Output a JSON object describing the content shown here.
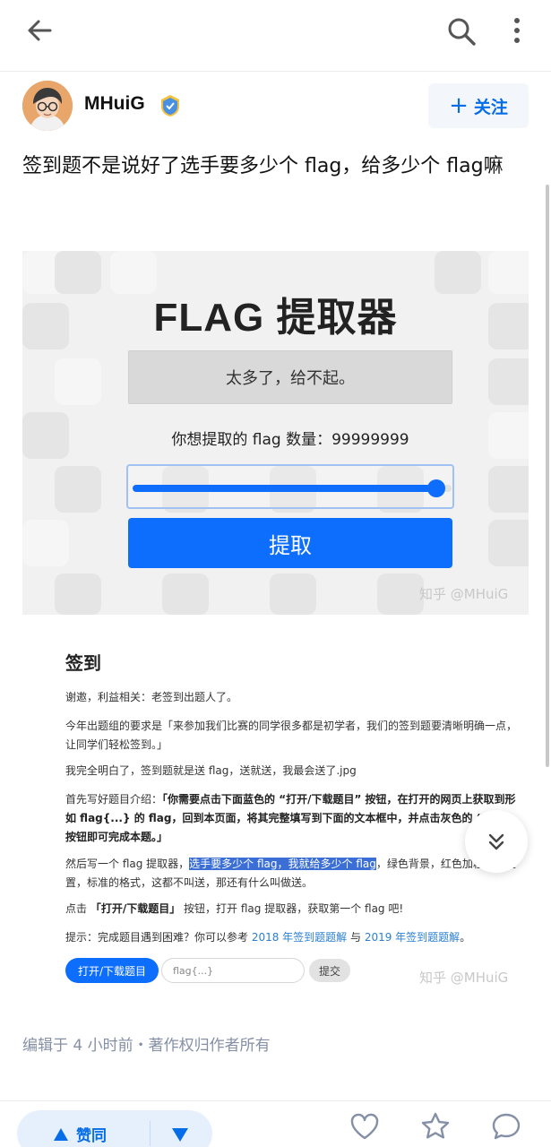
{
  "author": {
    "name": "MHuiG",
    "follow_label": "关注"
  },
  "answer": {
    "title": "签到题不是说好了选手要多少个 flag，给多少个 flag嘛",
    "edited": "编辑于 4 小时前・著作权归作者所有"
  },
  "image1": {
    "heading": "FLAG 提取器",
    "message": "太多了，给不起。",
    "count_label": "你想提取的 flag 数量：99999999",
    "slider_level": 0.96,
    "button": "提取",
    "watermark": "知乎 @MHuiG"
  },
  "image2": {
    "heading": "签到",
    "p1": "谢邀，利益相关：老签到出题人了。",
    "p2": "今年出题组的要求是「来参加我们比赛的同学很多都是初学者，我们的签到题要清晰明确一点，让同学们轻松签到。」",
    "p3": "我完全明白了，签到题就是送 flag，送就送，我最会送了.jpg",
    "p4_a": "首先写好题目介绍：",
    "p4_b": "「你需要点击下面蓝色的 “打开/下载题目” 按钮，在打开的网页上获取到形如 flag{...} 的 flag，回到本页面，将其完整填写到下面的文本框中，并点击灰色的 “提交” 按钮即可完成本题。」",
    "p5_a": "然后写一个 flag 提取器，",
    "p5_hl": "选手要多少个 flag，我就给多少个 flag",
    "p5_b": "，绿色背景，红色加粗，的位置，标准的格式，这都不叫送，那还有什么叫做送。",
    "p6_a": "点击 ",
    "p6_b": "「打开/下载题目」",
    "p6_c": " 按钮，打开 flag 提取器，获取第一个 flag 吧!",
    "p7_a": "提示：完成题目遇到困难？你可以参考 ",
    "p7_link1": "2018 年签到题题解",
    "p7_mid": " 与 ",
    "p7_link2": "2019 年签到题题解",
    "p7_end": "。",
    "download_button": "打开/下载题目",
    "input_placeholder": "flag{...}",
    "submit_button": "提交",
    "watermark": "知乎 @MHuiG"
  },
  "bottom": {
    "vote_label": "赞同"
  },
  "colors": {
    "accent": "#056de8",
    "button_blue": "#0d6efd"
  },
  "icons": [
    "back-arrow-icon",
    "search-icon",
    "more-vertical-icon",
    "verified-badge-icon",
    "plus-icon",
    "double-chevron-down-icon",
    "triangle-up-icon",
    "triangle-down-icon",
    "heart-icon",
    "star-icon",
    "comment-icon"
  ]
}
